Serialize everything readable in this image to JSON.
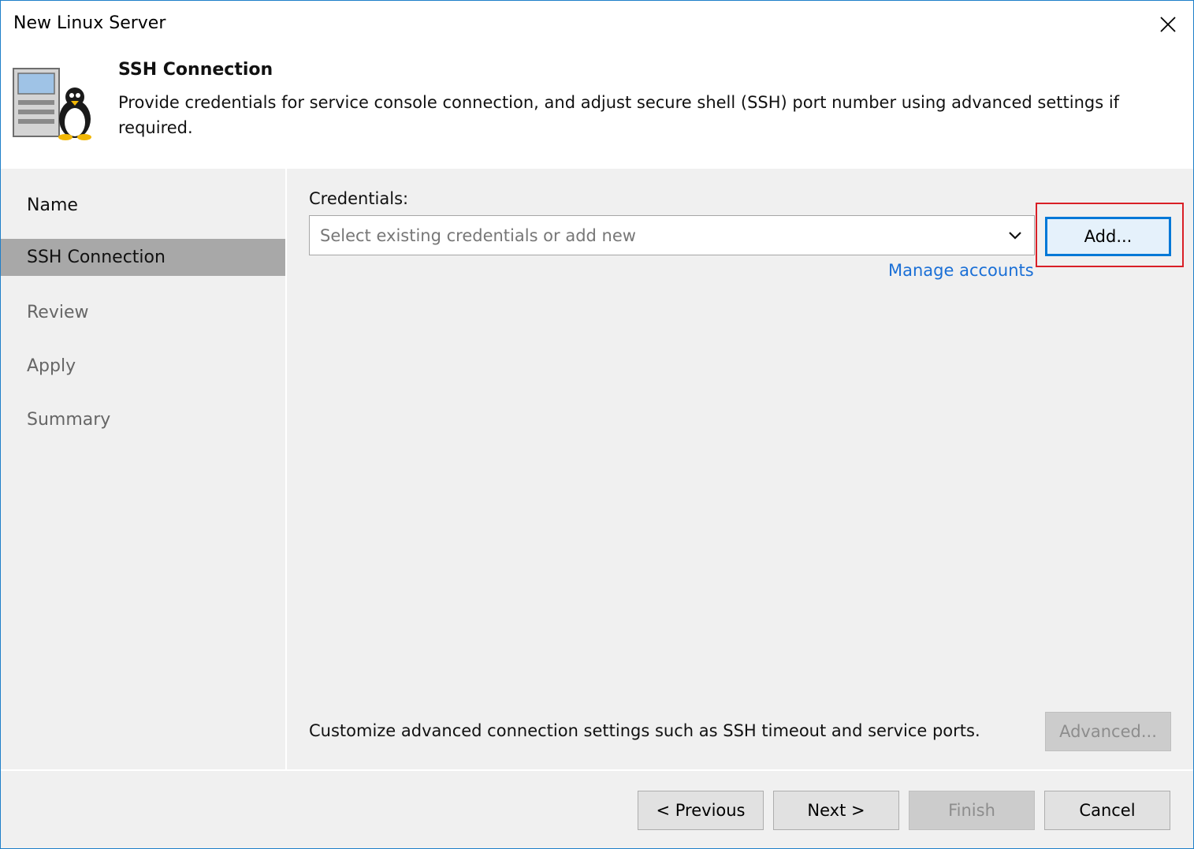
{
  "window": {
    "title": "New Linux Server"
  },
  "header": {
    "title": "SSH Connection",
    "description": "Provide credentials for service console connection, and adjust secure shell (SSH) port number using advanced settings if required."
  },
  "steps": [
    {
      "label": "Name",
      "state": "done"
    },
    {
      "label": "SSH Connection",
      "state": "active"
    },
    {
      "label": "Review",
      "state": "pending"
    },
    {
      "label": "Apply",
      "state": "pending"
    },
    {
      "label": "Summary",
      "state": "pending"
    }
  ],
  "credentials": {
    "label": "Credentials:",
    "placeholder": "Select existing credentials or add new",
    "add_button": "Add...",
    "manage_link": "Manage accounts"
  },
  "advanced": {
    "description": "Customize advanced connection settings such as SSH timeout and service ports.",
    "button": "Advanced..."
  },
  "footer": {
    "previous": "< Previous",
    "next": "Next >",
    "finish": "Finish",
    "cancel": "Cancel"
  },
  "icons": {
    "close": "close-icon",
    "header": "linux-server-icon",
    "dropdown": "chevron-down-icon"
  },
  "colors": {
    "active_step": "#a8a8a8",
    "link": "#1a6fd6",
    "highlight": "#d91f26",
    "focus_border": "#0078d7"
  }
}
